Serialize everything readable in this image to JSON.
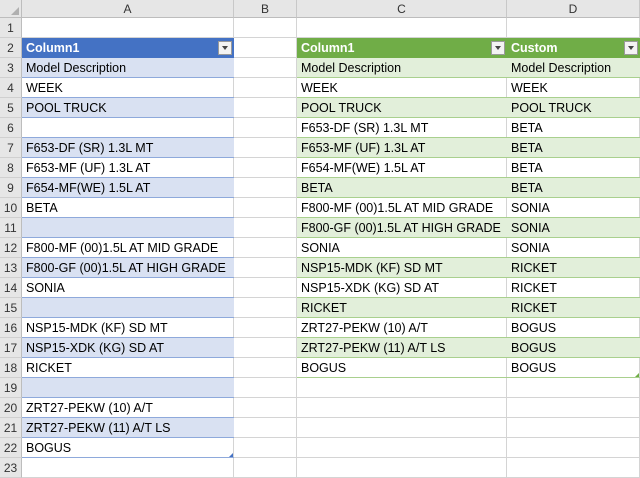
{
  "columns": [
    "A",
    "B",
    "C",
    "D"
  ],
  "rows": [
    "1",
    "2",
    "3",
    "4",
    "5",
    "6",
    "7",
    "8",
    "9",
    "10",
    "11",
    "12",
    "13",
    "14",
    "15",
    "16",
    "17",
    "18",
    "19",
    "20",
    "21",
    "22",
    "23"
  ],
  "table1": {
    "header": "Column1",
    "values": [
      "Model Description",
      "WEEK",
      "POOL TRUCK",
      "",
      "F653-DF (SR) 1.3L MT",
      "F653-MF (UF) 1.3L AT",
      "F654-MF(WE) 1.5L AT",
      "BETA",
      "",
      "F800-MF (00)1.5L AT MID GRADE",
      "F800-GF (00)1.5L AT HIGH GRADE",
      "SONIA",
      "",
      "NSP15-MDK (KF) SD MT",
      "NSP15-XDK (KG) SD AT",
      "RICKET",
      "",
      "ZRT27-PEKW (10) A/T",
      "ZRT27-PEKW (11) A/T LS",
      "BOGUS"
    ]
  },
  "table2": {
    "header_c": "Column1",
    "header_d": "Custom",
    "values_c": [
      "Model Description",
      "WEEK",
      "POOL TRUCK",
      "F653-DF (SR) 1.3L MT",
      "F653-MF (UF) 1.3L AT",
      "F654-MF(WE) 1.5L AT",
      "BETA",
      "F800-MF (00)1.5L AT MID GRADE",
      "F800-GF (00)1.5L AT HIGH GRADE",
      "SONIA",
      "NSP15-MDK (KF) SD MT",
      "NSP15-XDK (KG) SD AT",
      "RICKET",
      "ZRT27-PEKW (10) A/T",
      "ZRT27-PEKW (11) A/T LS",
      "BOGUS"
    ],
    "values_d": [
      "Model Description",
      "WEEK",
      "POOL TRUCK",
      "BETA",
      "BETA",
      "BETA",
      "BETA",
      "SONIA",
      "SONIA",
      "SONIA",
      "RICKET",
      "RICKET",
      "RICKET",
      "BOGUS",
      "BOGUS",
      "BOGUS"
    ]
  },
  "icons": {
    "filter": "filter-dropdown-icon",
    "corner": "select-all-icon"
  },
  "colors": {
    "table1_header": "#4472c4",
    "table1_band": "#d9e1f2",
    "table2_header": "#70ad47",
    "table2_band": "#e2efda"
  }
}
